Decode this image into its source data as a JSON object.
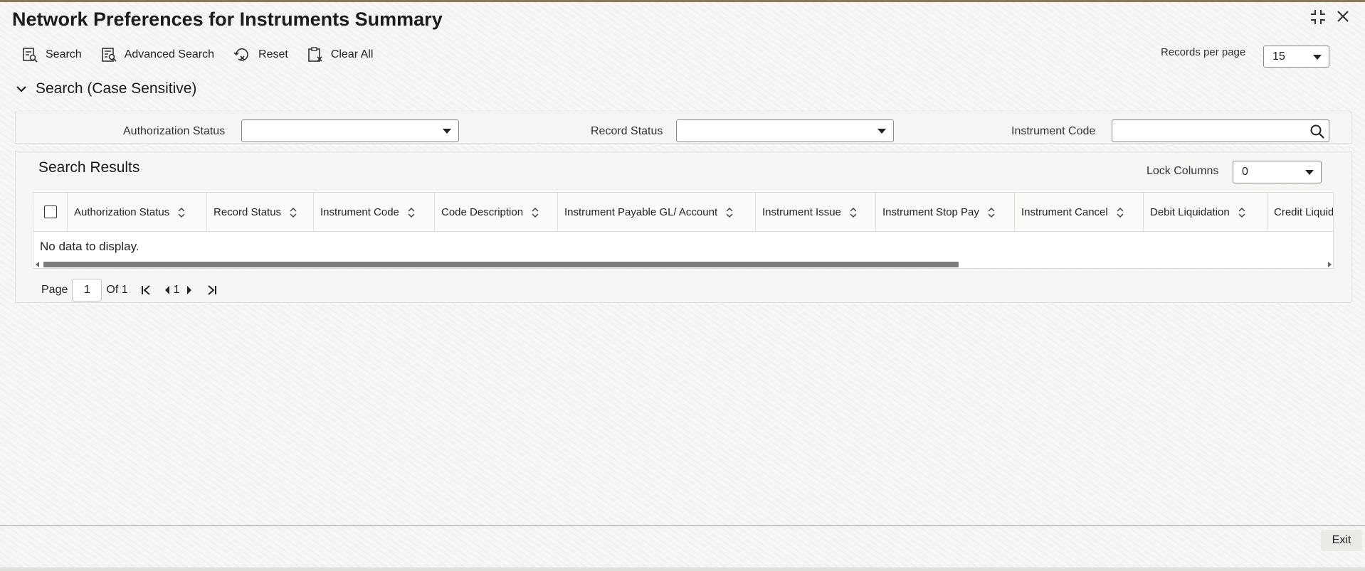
{
  "window": {
    "title": "Network Preferences for Instruments Summary",
    "maximize_icon": "maximize-icon",
    "close_icon": "close-icon"
  },
  "toolbar": {
    "search_label": "Search",
    "advanced_search_label": "Advanced Search",
    "reset_label": "Reset",
    "clear_all_label": "Clear All"
  },
  "records_per_page": {
    "label": "Records per page",
    "value": "15"
  },
  "search_section": {
    "title": "Search (Case Sensitive)",
    "authorization_status_label": "Authorization Status",
    "authorization_status_value": "",
    "record_status_label": "Record Status",
    "record_status_value": "",
    "instrument_code_label": "Instrument Code",
    "instrument_code_value": ""
  },
  "results": {
    "title": "Search Results",
    "lock_columns_label": "Lock Columns",
    "lock_columns_value": "0",
    "columns": [
      "Authorization Status",
      "Record Status",
      "Instrument Code",
      "Code Description",
      "Instrument Payable GL/ Account",
      "Instrument Issue",
      "Instrument Stop Pay",
      "Instrument Cancel",
      "Debit Liquidation",
      "Credit Liquidation"
    ],
    "empty_message": "No data to display."
  },
  "pager": {
    "page_label": "Page",
    "current_page": "1",
    "of_label": "Of 1",
    "page_link": "1"
  },
  "footer": {
    "exit_label": "Exit"
  }
}
